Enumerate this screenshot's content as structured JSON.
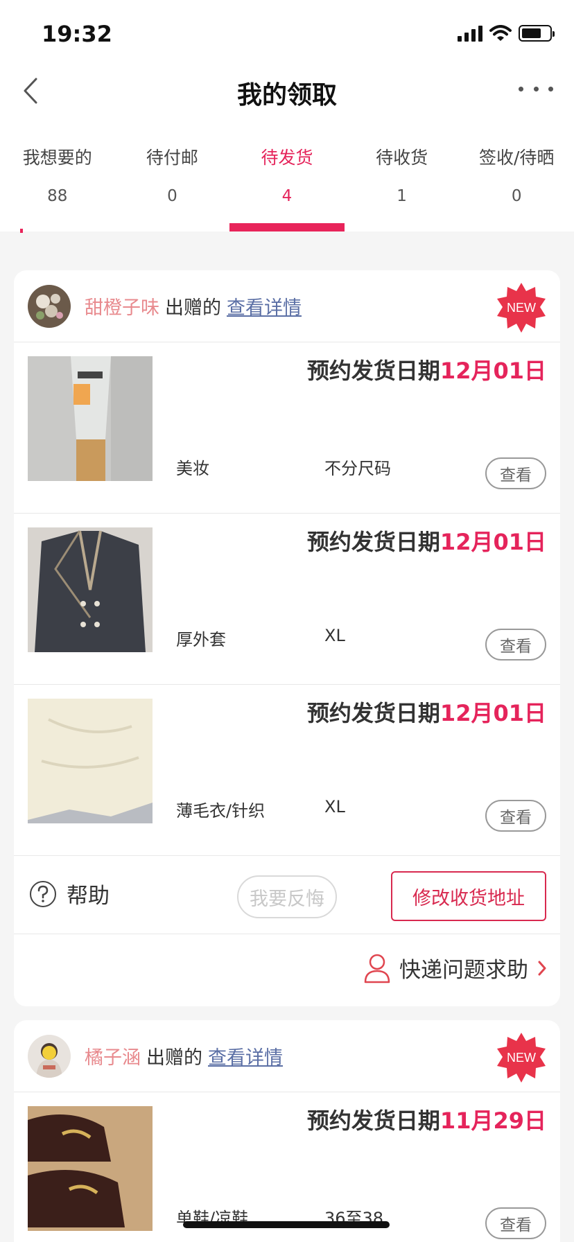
{
  "status_bar": {
    "time": "19:32"
  },
  "nav": {
    "title": "我的领取"
  },
  "tabs": [
    {
      "label": "我想要的",
      "count": "88"
    },
    {
      "label": "待付邮",
      "count": "0"
    },
    {
      "label": "待发货",
      "count": "4"
    },
    {
      "label": "待收货",
      "count": "1"
    },
    {
      "label": "签收/待晒",
      "count": "0"
    }
  ],
  "active_tab": "待发货",
  "accent_color": "#e5245b",
  "cards": [
    {
      "giver": "甜橙子味",
      "gave_text": "出赠的",
      "detail_link": "查看详情",
      "badge": "NEW",
      "items": [
        {
          "ship_label": "预约发货日期",
          "ship_date": "12月01日",
          "category": "美妆",
          "size": "不分尺码",
          "view": "查看"
        },
        {
          "ship_label": "预约发货日期",
          "ship_date": "12月01日",
          "category": "厚外套",
          "size": "XL",
          "view": "查看"
        },
        {
          "ship_label": "预约发货日期",
          "ship_date": "12月01日",
          "category": "薄毛衣/针织",
          "size": "XL",
          "view": "查看"
        }
      ],
      "help_label": "帮助",
      "regret_label": "我要反悔",
      "address_label": "修改收货地址",
      "express_help_label": "快递问题求助"
    },
    {
      "giver": "橘子涵",
      "gave_text": "出赠的",
      "detail_link": "查看详情",
      "badge": "NEW",
      "items": [
        {
          "ship_label": "预约发货日期",
          "ship_date": "11月29日",
          "category": "单鞋/凉鞋",
          "size": "36至38",
          "view": "查看"
        }
      ]
    }
  ]
}
